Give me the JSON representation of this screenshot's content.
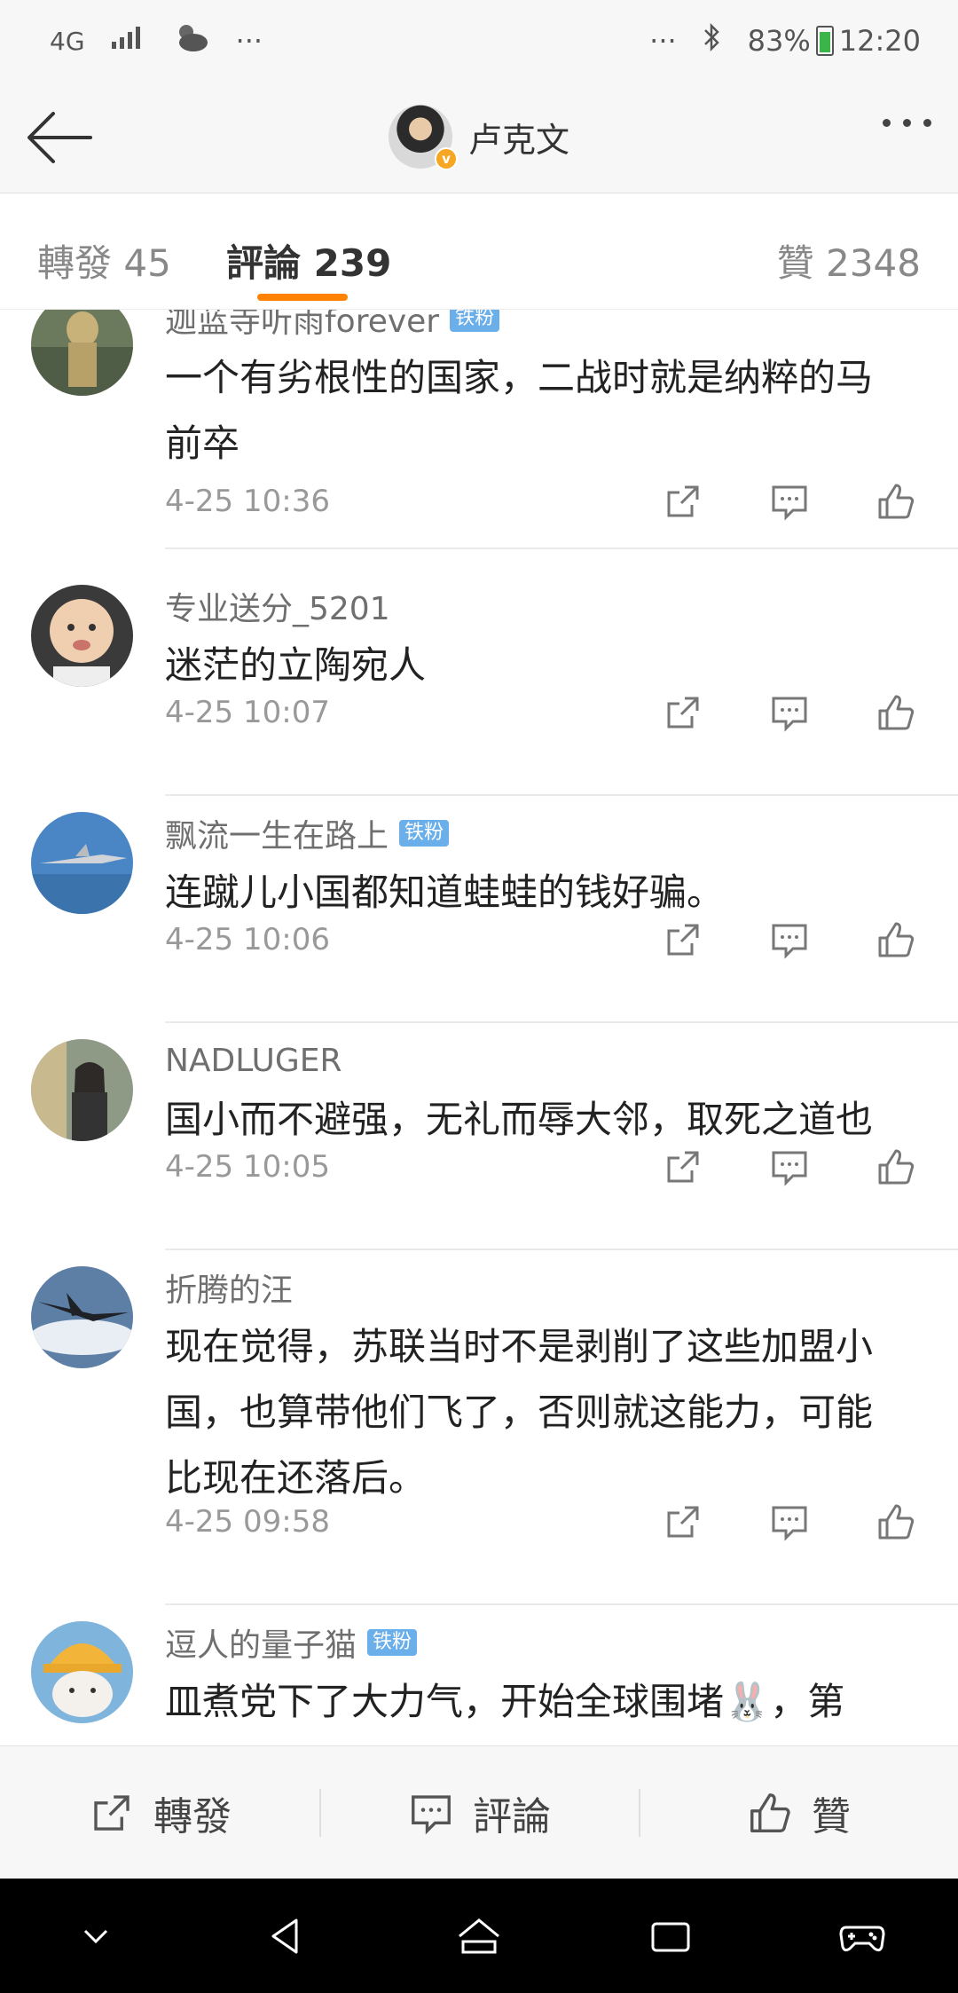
{
  "status_bar": {
    "network": "4G",
    "more": "···",
    "more_right": "···",
    "battery": "83%",
    "time": "12:20"
  },
  "header": {
    "title": "卢克文",
    "verified_mark": "v"
  },
  "tabs": {
    "repost": "轉發 45",
    "comments": "評論 239",
    "likes": "贊 2348"
  },
  "comments": [
    {
      "name": "迦蓝寺听雨forever",
      "badge": "铁粉",
      "lines": [
        "一个有劣根性的国家，二战时就是纳粹的马",
        "前卒"
      ],
      "time": "4-25 10:36"
    },
    {
      "name": "专业送分_5201",
      "badge": "",
      "lines": [
        "迷茫的立陶宛人"
      ],
      "time": "4-25 10:07"
    },
    {
      "name": "飘流一生在路上",
      "badge": "铁粉",
      "lines": [
        "连蹴儿小国都知道蛙蛙的钱好骗。"
      ],
      "time": "4-25 10:06"
    },
    {
      "name": "NADLUGER",
      "badge": "",
      "lines": [
        "国小而不避强，无礼而辱大邻，取死之道也"
      ],
      "time": "4-25 10:05"
    },
    {
      "name": "折腾的汪",
      "badge": "",
      "lines": [
        "现在觉得，苏联当时不是剥削了这些加盟小",
        "国，也算带他们飞了，否则就这能力，可能",
        "比现在还落后。"
      ],
      "time": "4-25 09:58"
    },
    {
      "name": "逗人的量子猫",
      "badge": "铁粉",
      "lines": [
        "皿煮党下了大力气，开始全球围堵🐰，第"
      ],
      "time": ""
    }
  ],
  "bottom_bar": {
    "repost": "轉發",
    "comment": "評論",
    "like": "贊"
  },
  "icons": {
    "accent": "#ff8200",
    "badge_color": "#6aaeea"
  }
}
